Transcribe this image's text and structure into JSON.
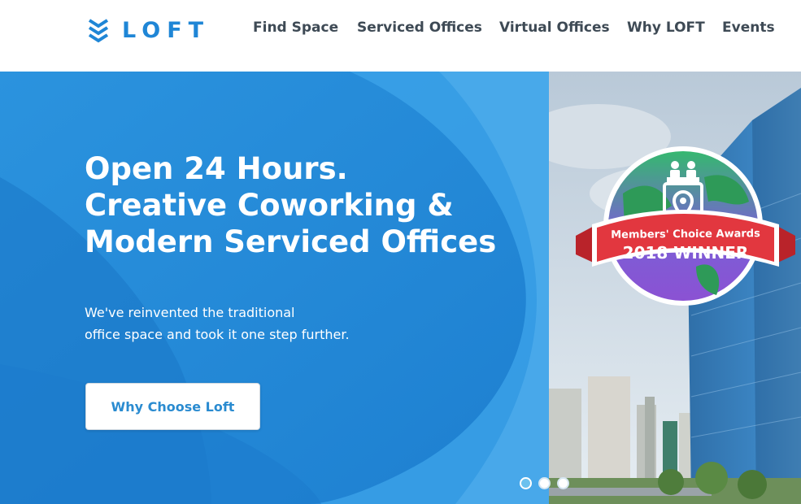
{
  "header": {
    "logo_text": "LOFT",
    "nav": [
      {
        "label": "Find Space"
      },
      {
        "label": "Serviced Offices"
      },
      {
        "label": "Virtual Offices"
      },
      {
        "label": "Why LOFT"
      },
      {
        "label": "Events"
      }
    ]
  },
  "hero": {
    "headline": [
      "Open 24 Hours.",
      "Creative Coworking &",
      "Modern Serviced Offices"
    ],
    "subtext": [
      "We've reinvented the traditional",
      "office space and took it one step further."
    ],
    "cta_label": "Why Choose Loft",
    "badge": {
      "line1": "Members' Choice Awards",
      "line2": "2018 WINNER"
    },
    "slides": {
      "count": 3,
      "active": 1
    }
  },
  "colors": {
    "brand": "#1f86d6",
    "nav_text": "#3e4a55",
    "hero_blue": "#2a8fdc",
    "badge_red": "#e2373f",
    "badge_purple": "#8a54d6",
    "badge_green": "#2fb36a"
  },
  "icons": [
    "loft-chevrons-logo",
    "location-pin-icon",
    "people-podium-icon"
  ]
}
